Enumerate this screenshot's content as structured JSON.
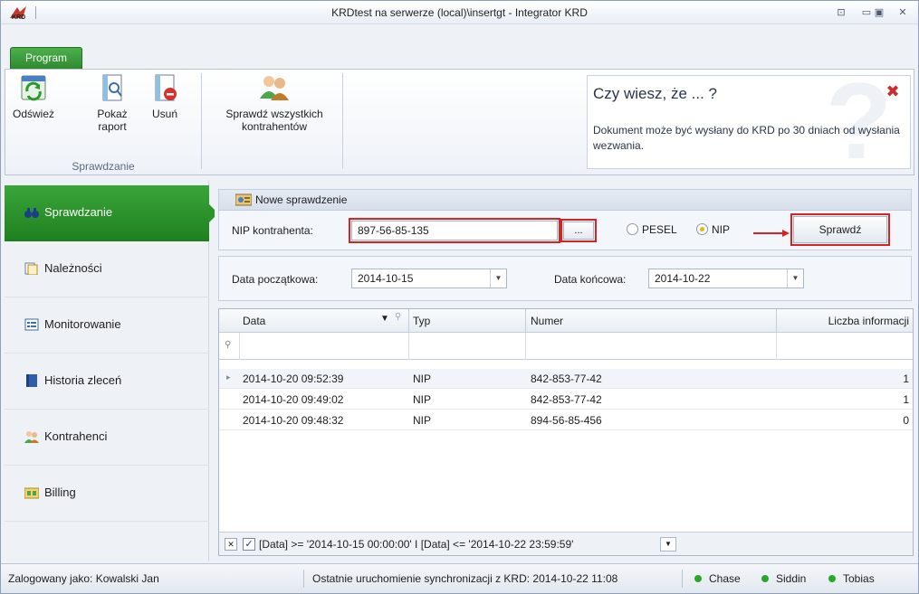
{
  "window": {
    "title": "KRDtest na serwerze (local)\\insertgt - Integrator KRD",
    "logo_text": "KRD",
    "controls": {
      "restore": "⊡",
      "minimize": "▭",
      "maximize": "▣",
      "close": "✕"
    }
  },
  "ribbon": {
    "tab": "Program",
    "buttons": {
      "refresh": "Odśwież",
      "show_report": "Pokaż raport",
      "delete": "Usuń",
      "check_all": "Sprawdź wszystkich kontrahentów"
    },
    "group_label": "Sprawdzanie",
    "tip": {
      "title": "Czy wiesz, że ... ?",
      "body": "Dokument może być wysłany do KRD po 30 dniach od wysłania wezwania.",
      "close": "✖",
      "watermark": "?"
    }
  },
  "sidebar": {
    "items": [
      {
        "label": "Sprawdzanie",
        "icon": "binoculars-icon",
        "active": true
      },
      {
        "label": "Należności",
        "icon": "documents-icon"
      },
      {
        "label": "Monitorowanie",
        "icon": "monitor-list-icon"
      },
      {
        "label": "Historia zleceń",
        "icon": "book-icon"
      },
      {
        "label": "Kontrahenci",
        "icon": "people-icon"
      },
      {
        "label": "Billing",
        "icon": "billing-icon"
      }
    ]
  },
  "check": {
    "header": "Nowe sprawdzenie",
    "nip_label": "NIP kontrahenta:",
    "nip_value": "897-56-85-135",
    "ellipsis": "...",
    "radio_pesel": "PESEL",
    "radio_nip": "NIP",
    "selected": "NIP",
    "check_button": "Sprawdź"
  },
  "dates": {
    "from_label": "Data początkowa:",
    "from_value": "2014-10-15",
    "to_label": "Data końcowa:",
    "to_value": "2014-10-22",
    "dropdown_glyph": "▼"
  },
  "grid": {
    "columns": [
      "Data",
      "Typ",
      "Numer",
      "Liczba informacji"
    ],
    "sort_glyph": "▼",
    "filter_glyph": "⚲",
    "row_indicator": "▸",
    "rows": [
      [
        "2014-10-20 09:52:39",
        "NIP",
        "842-853-77-42",
        "1"
      ],
      [
        "2014-10-20 09:49:02",
        "NIP",
        "842-853-77-42",
        "1"
      ],
      [
        "2014-10-20 09:48:32",
        "NIP",
        "894-56-85-456",
        "0"
      ]
    ],
    "filter_text": "[Data] >= '2014-10-15 00:00:00' I [Data] <= '2014-10-22 23:59:59'",
    "filter_clear": "✕",
    "filter_check": "✓",
    "filter_dropdown": "▼"
  },
  "status": {
    "logged_in": "Zalogowany jako: Kowalski Jan",
    "last_sync": "Ostatnie uruchomienie synchronizacji z KRD: 2014-10-22 11:08",
    "servers": [
      {
        "name": "Chase",
        "color": "#2aa82a"
      },
      {
        "name": "Siddin",
        "color": "#2aa82a"
      },
      {
        "name": "Tobias",
        "color": "#2aa82a"
      }
    ]
  },
  "colors": {
    "accent_green": "#2f8a2f",
    "highlight_red": "#d92222"
  }
}
